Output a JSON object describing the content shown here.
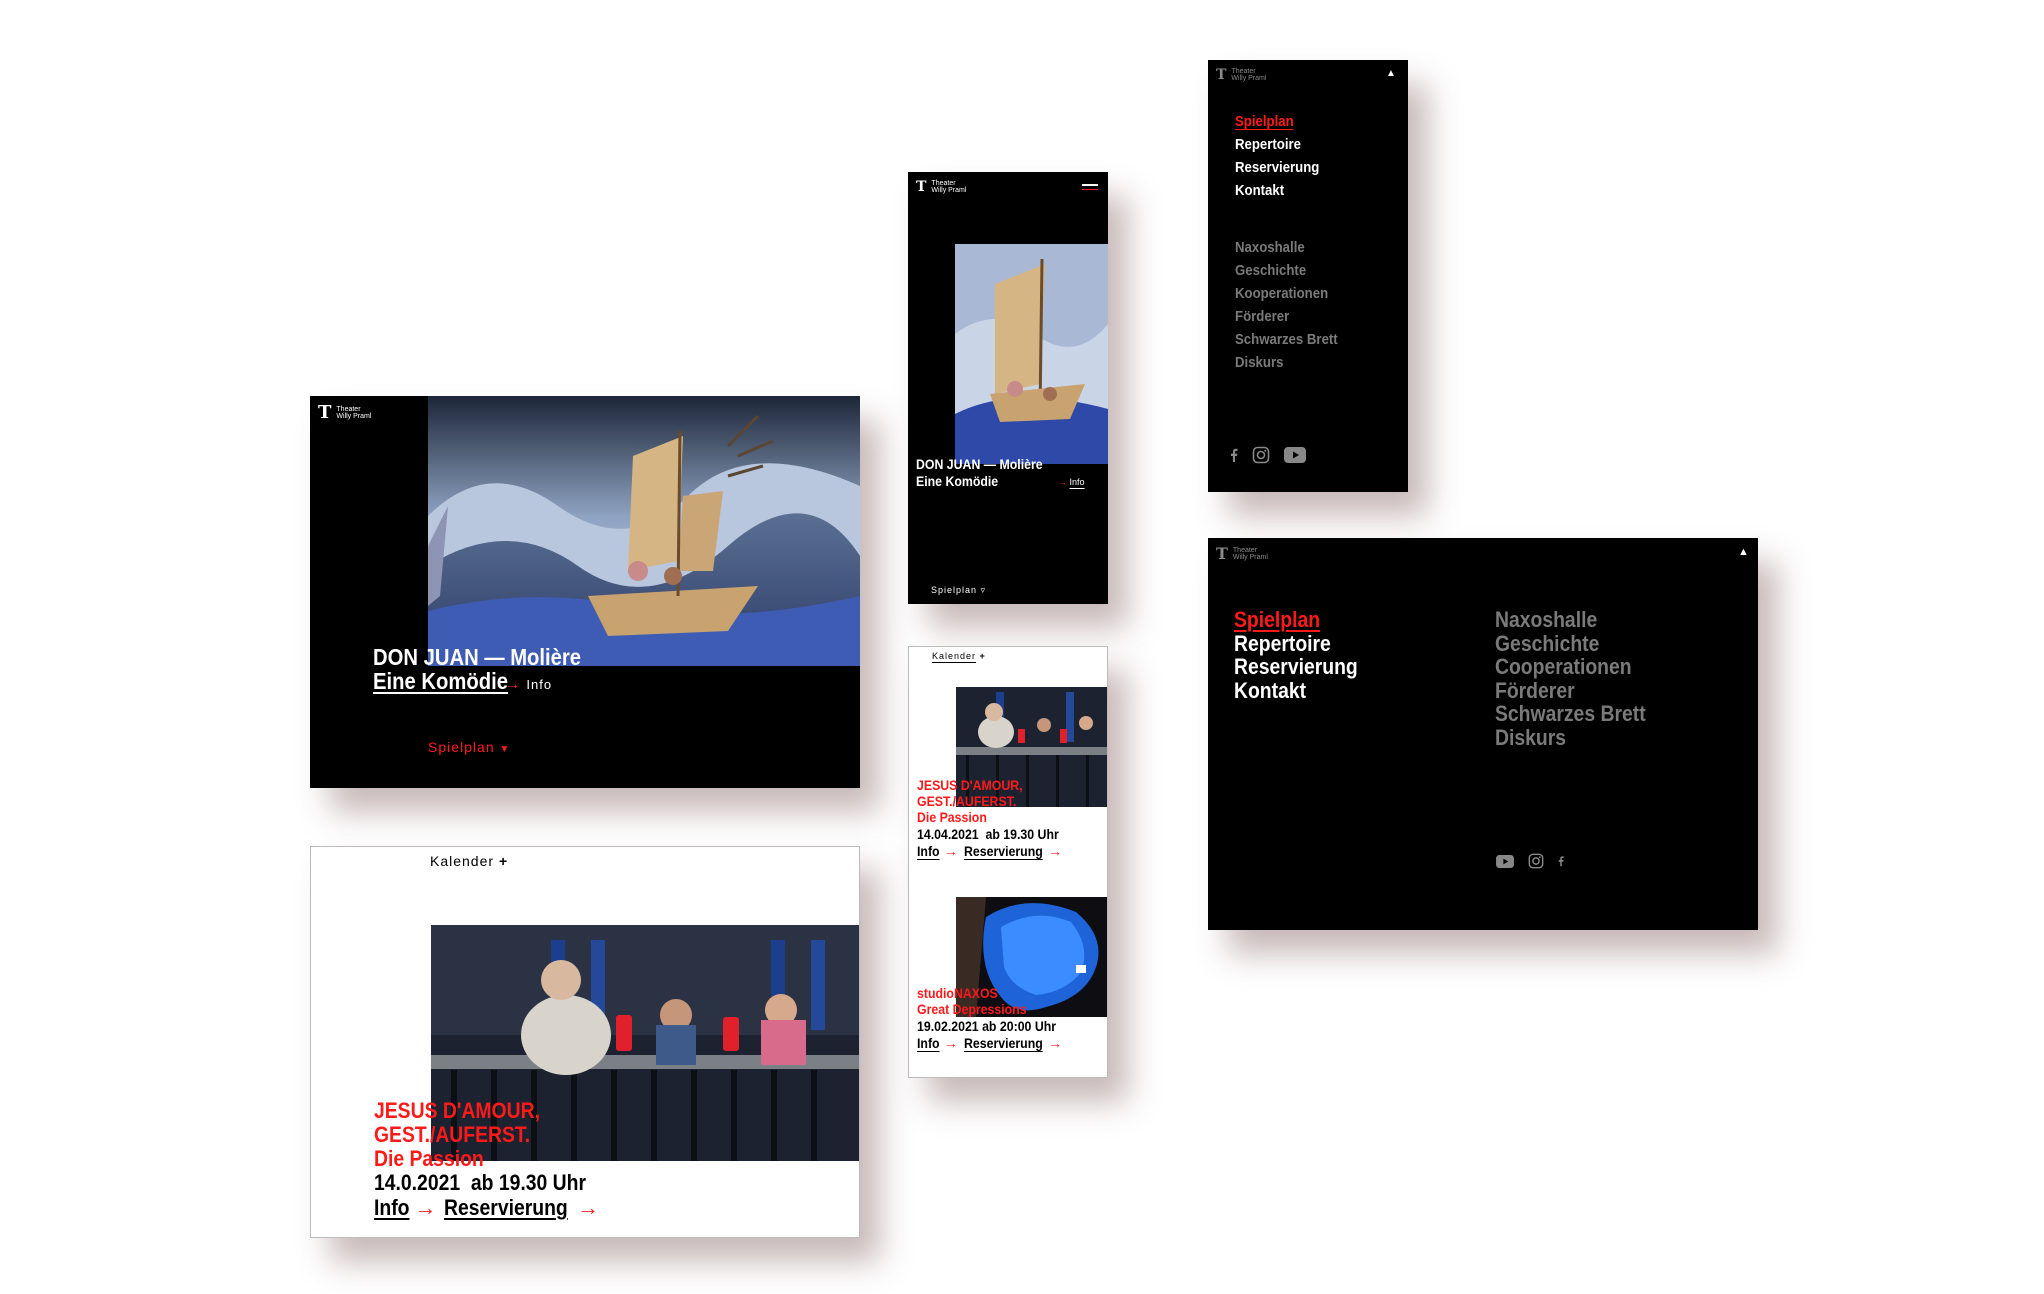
{
  "brand": {
    "mark": "T",
    "line1": "Theater",
    "line2": "Willy Praml"
  },
  "hero": {
    "title": "DON JUAN — Molière",
    "subtitle": "Eine Komödie",
    "info": "Info",
    "spielplan": "Spielplan",
    "spielplan_arrow": "▼",
    "spielplan_arrow_mobile": "▿"
  },
  "calendar": {
    "label": "Kalender",
    "plus": "+",
    "event1": {
      "title_line1": "JESUS D'AMOUR,",
      "title_line2": "GEST./AUFERST.",
      "subtitle": "Die Passion",
      "date_desktop": "14.0.2021  ab 19.30 Uhr",
      "date_mobile": "14.04.2021  ab 19.30 Uhr"
    },
    "event2": {
      "title_line1": "studioNAXOS",
      "title_line2": "Great Depressions",
      "date": "19.02.2021 ab 20:00 Uhr"
    },
    "info": "Info",
    "reservation": "Reservierung",
    "arrow": "→"
  },
  "menu": {
    "close": "▲",
    "primary": [
      "Spielplan",
      "Repertoire",
      "Reservierung",
      "Kontakt"
    ],
    "secondary_mobile": [
      "Naxoshalle",
      "Geschichte",
      "Kooperationen",
      "Förderer",
      "Schwarzes Brett",
      "Diskurs"
    ],
    "secondary_desktop": [
      "Naxoshalle",
      "Geschichte",
      "Cooperationen",
      "Förderer",
      "Schwarzes Brett",
      "Diskurs"
    ],
    "social_mobile": [
      "facebook-icon",
      "instagram-icon",
      "youtube-icon"
    ],
    "social_desktop": [
      "youtube-icon",
      "instagram-icon",
      "facebook-icon"
    ]
  },
  "colors": {
    "accent": "#ff1a1a",
    "background": "#000000",
    "muted": "#7a7a7a"
  }
}
